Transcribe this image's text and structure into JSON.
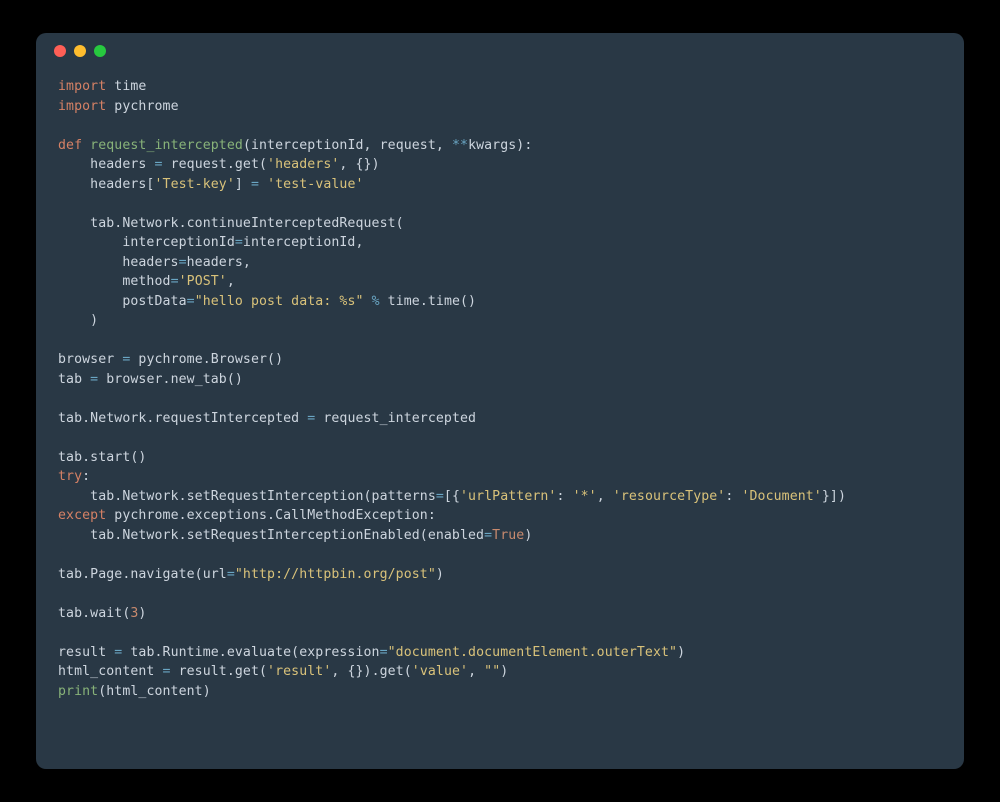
{
  "window": {
    "traffic": {
      "close": "close",
      "min": "minimize",
      "max": "maximize"
    }
  },
  "code": {
    "lines": [
      [
        {
          "c": "kw",
          "t": "import"
        },
        {
          "c": "plain",
          "t": " time"
        }
      ],
      [
        {
          "c": "kw",
          "t": "import"
        },
        {
          "c": "plain",
          "t": " pychrome"
        }
      ],
      [],
      [
        {
          "c": "kw",
          "t": "def "
        },
        {
          "c": "fn",
          "t": "request_intercepted"
        },
        {
          "c": "plain",
          "t": "(interceptionId, request, "
        },
        {
          "c": "op",
          "t": "**"
        },
        {
          "c": "plain",
          "t": "kwargs):"
        }
      ],
      [
        {
          "c": "plain",
          "t": "    headers "
        },
        {
          "c": "op",
          "t": "="
        },
        {
          "c": "plain",
          "t": " request.get("
        },
        {
          "c": "str",
          "t": "'headers'"
        },
        {
          "c": "plain",
          "t": ", {})"
        }
      ],
      [
        {
          "c": "plain",
          "t": "    headers["
        },
        {
          "c": "str",
          "t": "'Test-key'"
        },
        {
          "c": "plain",
          "t": "] "
        },
        {
          "c": "op",
          "t": "="
        },
        {
          "c": "plain",
          "t": " "
        },
        {
          "c": "str",
          "t": "'test-value'"
        }
      ],
      [],
      [
        {
          "c": "plain",
          "t": "    tab.Network.continueInterceptedRequest("
        }
      ],
      [
        {
          "c": "plain",
          "t": "        interceptionId"
        },
        {
          "c": "op",
          "t": "="
        },
        {
          "c": "plain",
          "t": "interceptionId,"
        }
      ],
      [
        {
          "c": "plain",
          "t": "        headers"
        },
        {
          "c": "op",
          "t": "="
        },
        {
          "c": "plain",
          "t": "headers,"
        }
      ],
      [
        {
          "c": "plain",
          "t": "        method"
        },
        {
          "c": "op",
          "t": "="
        },
        {
          "c": "str",
          "t": "'POST'"
        },
        {
          "c": "plain",
          "t": ","
        }
      ],
      [
        {
          "c": "plain",
          "t": "        postData"
        },
        {
          "c": "op",
          "t": "="
        },
        {
          "c": "str",
          "t": "\"hello post data: %s\""
        },
        {
          "c": "plain",
          "t": " "
        },
        {
          "c": "op",
          "t": "%"
        },
        {
          "c": "plain",
          "t": " time.time()"
        }
      ],
      [
        {
          "c": "plain",
          "t": "    )"
        }
      ],
      [],
      [
        {
          "c": "plain",
          "t": "browser "
        },
        {
          "c": "op",
          "t": "="
        },
        {
          "c": "plain",
          "t": " pychrome.Browser()"
        }
      ],
      [
        {
          "c": "plain",
          "t": "tab "
        },
        {
          "c": "op",
          "t": "="
        },
        {
          "c": "plain",
          "t": " browser.new_tab()"
        }
      ],
      [],
      [
        {
          "c": "plain",
          "t": "tab.Network.requestIntercepted "
        },
        {
          "c": "op",
          "t": "="
        },
        {
          "c": "plain",
          "t": " request_intercepted"
        }
      ],
      [],
      [
        {
          "c": "plain",
          "t": "tab.start()"
        }
      ],
      [
        {
          "c": "kw",
          "t": "try"
        },
        {
          "c": "plain",
          "t": ":"
        }
      ],
      [
        {
          "c": "plain",
          "t": "    tab.Network.setRequestInterception(patterns"
        },
        {
          "c": "op",
          "t": "="
        },
        {
          "c": "plain",
          "t": "[{"
        },
        {
          "c": "str",
          "t": "'urlPattern'"
        },
        {
          "c": "plain",
          "t": ": "
        },
        {
          "c": "str",
          "t": "'*'"
        },
        {
          "c": "plain",
          "t": ", "
        },
        {
          "c": "str",
          "t": "'resourceType'"
        },
        {
          "c": "plain",
          "t": ": "
        },
        {
          "c": "str",
          "t": "'Document'"
        },
        {
          "c": "plain",
          "t": "}])"
        }
      ],
      [
        {
          "c": "kw",
          "t": "except"
        },
        {
          "c": "plain",
          "t": " pychrome.exceptions.CallMethodException:"
        }
      ],
      [
        {
          "c": "plain",
          "t": "    tab.Network.setRequestInterceptionEnabled(enabled"
        },
        {
          "c": "op",
          "t": "="
        },
        {
          "c": "bool",
          "t": "True"
        },
        {
          "c": "plain",
          "t": ")"
        }
      ],
      [],
      [
        {
          "c": "plain",
          "t": "tab.Page.navigate(url"
        },
        {
          "c": "op",
          "t": "="
        },
        {
          "c": "str",
          "t": "\"http://httpbin.org/post\""
        },
        {
          "c": "plain",
          "t": ")"
        }
      ],
      [],
      [
        {
          "c": "plain",
          "t": "tab.wait("
        },
        {
          "c": "num",
          "t": "3"
        },
        {
          "c": "plain",
          "t": ")"
        }
      ],
      [],
      [
        {
          "c": "plain",
          "t": "result "
        },
        {
          "c": "op",
          "t": "="
        },
        {
          "c": "plain",
          "t": " tab.Runtime.evaluate(expression"
        },
        {
          "c": "op",
          "t": "="
        },
        {
          "c": "str",
          "t": "\"document.documentElement.outerText\""
        },
        {
          "c": "plain",
          "t": ")"
        }
      ],
      [
        {
          "c": "plain",
          "t": "html_content "
        },
        {
          "c": "op",
          "t": "="
        },
        {
          "c": "plain",
          "t": " result.get("
        },
        {
          "c": "str",
          "t": "'result'"
        },
        {
          "c": "plain",
          "t": ", {}).get("
        },
        {
          "c": "str",
          "t": "'value'"
        },
        {
          "c": "plain",
          "t": ", "
        },
        {
          "c": "str",
          "t": "\"\""
        },
        {
          "c": "plain",
          "t": ")"
        }
      ],
      [
        {
          "c": "builtin",
          "t": "print"
        },
        {
          "c": "plain",
          "t": "(html_content)"
        }
      ]
    ]
  }
}
